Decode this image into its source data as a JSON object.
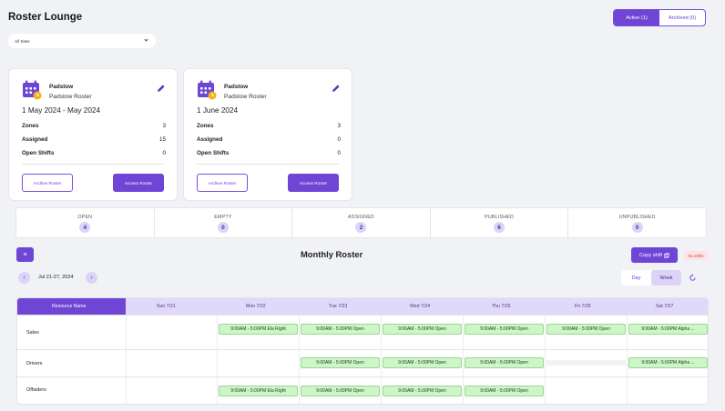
{
  "header": {
    "title": "Roster Lounge"
  },
  "tabs": [
    {
      "label": "Active (1)"
    },
    {
      "label": "Archived (0)"
    }
  ],
  "filter": {
    "site_value": "All Sites"
  },
  "cards": [
    {
      "site": "Padstow",
      "roster": "Padstow Roster",
      "dates": "1 May 2024 - May 2024",
      "stats": [
        {
          "label": "Zones",
          "value": "3"
        },
        {
          "label": "Assigned",
          "value": "15"
        },
        {
          "label": "Open Shifts",
          "value": "0"
        }
      ],
      "archive_label": "Archive Roster",
      "access_label": "Access Roster"
    },
    {
      "site": "Padstow",
      "roster": "Padstow  Roster",
      "dates": "1 June 2024",
      "stats": [
        {
          "label": "Zones",
          "value": "3"
        },
        {
          "label": "Assigned",
          "value": "0"
        },
        {
          "label": "Open Shifts",
          "value": "0"
        }
      ],
      "archive_label": "Archive Roster",
      "access_label": "Access Roster"
    }
  ],
  "summary": [
    {
      "label": "OPEN",
      "value": "4"
    },
    {
      "label": "EMPTY",
      "value": "0"
    },
    {
      "label": "ASSIGNED",
      "value": "2"
    },
    {
      "label": "PUBLISHED",
      "value": "6"
    },
    {
      "label": "UNPUBLISHED",
      "value": "0"
    }
  ],
  "toolbar": {
    "menu_icon": "≡",
    "title": "Monthly Roster",
    "copy_label": "Copy shift",
    "no_shifts": "No Shifts",
    "date_range": "Jul 21-27, 2024",
    "prev_icon": "‹",
    "next_icon": "›",
    "views": [
      {
        "label": "Day"
      },
      {
        "label": "Week"
      }
    ]
  },
  "grid": {
    "resource_header": "Resource Name",
    "days": [
      "Sun 7/21",
      "Mon 7/22",
      "Tue 7/23",
      "Wed 7/24",
      "Thu 7/25",
      "Fri 7/26",
      "Sat 7/27"
    ],
    "rows": [
      {
        "name": "Sales",
        "shifts": [
          "",
          "9:00AM - 5:00PM Ela Right",
          "9:00AM - 5:00PM Open",
          "9:00AM - 5:00PM Open",
          "9:00AM - 5:00PM Open",
          "9:00AM - 5:00PM Open",
          "9:00AM - 5:00PM Alpha ..."
        ]
      },
      {
        "name": "Drivers",
        "shifts": [
          "",
          "",
          "9:00AM - 5:00PM Open",
          "9:00AM - 5:00PM Open",
          "9:00AM - 5:00PM Open",
          "",
          "9:00AM - 5:00PM Alpha ..."
        ]
      },
      {
        "name": "Offsiders",
        "shifts": [
          "",
          "9:00AM - 5:00PM Ela Right",
          "9:00AM - 5:00PM Open",
          "9:00AM - 5:00PM Open",
          "9:00AM - 5:00PM Open",
          "",
          ""
        ]
      }
    ]
  },
  "colors": {
    "accent": "#6f45d6",
    "accent_light": "#ddd3f7",
    "shift_bg": "#cdf5c8",
    "danger": "#d04242"
  },
  "icons": {
    "calendar": "calendar-icon",
    "edit": "pencil-icon",
    "refresh": "refresh-icon",
    "copy": "copy-icon"
  }
}
